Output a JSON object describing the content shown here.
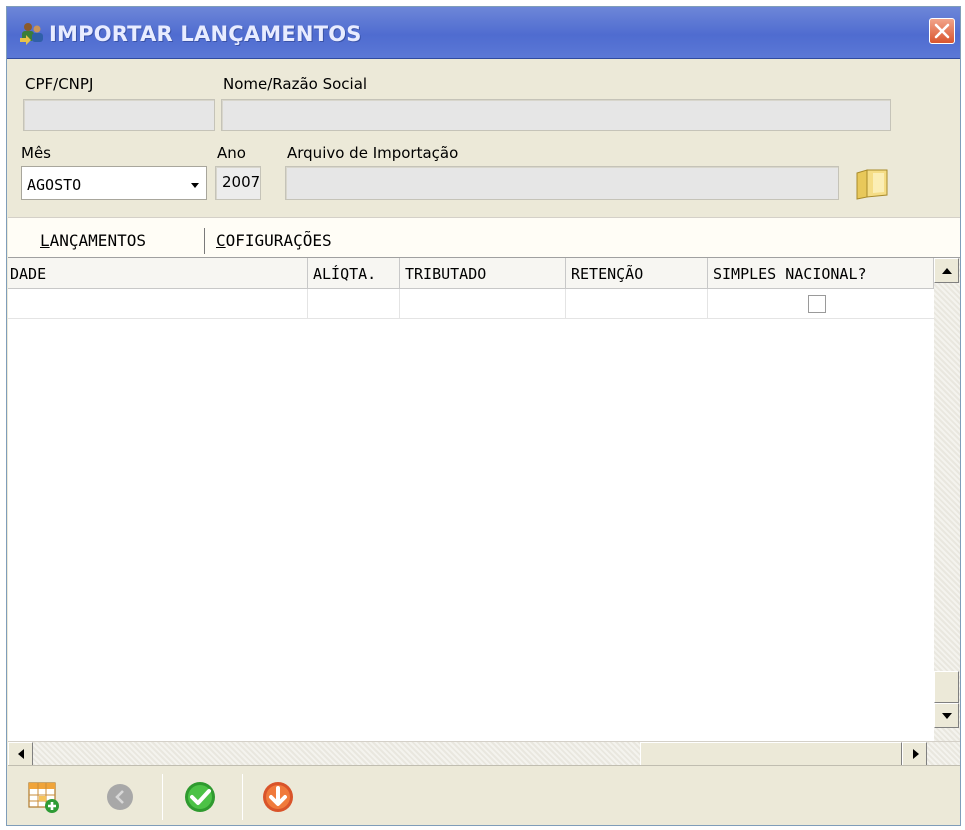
{
  "window": {
    "title": "IMPORTAR LANÇAMENTOS",
    "accent": "#5470d2"
  },
  "form": {
    "cpf_label": "CPF/CNPJ",
    "cpf_value": "",
    "nome_label": "Nome/Razão Social",
    "nome_value": "",
    "mes_label": "Mês",
    "mes_value": "AGOSTO",
    "ano_label": "Ano",
    "ano_value": "2007",
    "arquivo_label": "Arquivo de Importação",
    "arquivo_value": ""
  },
  "tabs": [
    {
      "label": "LANÇAMENTOS",
      "selected": true
    },
    {
      "label": "COFIGURAÇÕES",
      "selected": false
    }
  ],
  "grid": {
    "columns": [
      "DADE",
      "ALÍQTA.",
      "TRIBUTADO",
      "RETENÇÃO",
      "SIMPLES NACIONAL?"
    ],
    "rows": [
      {
        "cells": [
          "",
          "",
          "",
          ""
        ],
        "simples_nacional": false
      }
    ]
  },
  "toolbar": {
    "buttons": [
      "add-row-icon",
      "back-icon",
      "confirm-icon",
      "download-icon"
    ]
  }
}
